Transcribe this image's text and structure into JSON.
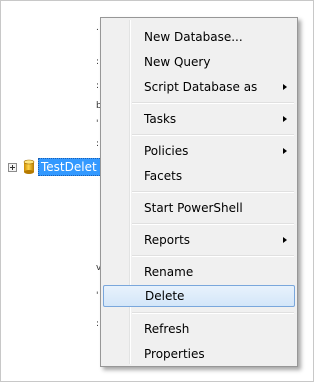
{
  "tree": {
    "node_label": "TestDelet"
  },
  "menu": {
    "items": [
      {
        "label": "New Database...",
        "submenu": false
      },
      {
        "label": "New Query",
        "submenu": false
      },
      {
        "label": "Script Database as",
        "submenu": true
      },
      {
        "label": "Tasks",
        "submenu": true
      },
      {
        "label": "Policies",
        "submenu": true
      },
      {
        "label": "Facets",
        "submenu": false
      },
      {
        "label": "Start PowerShell",
        "submenu": false
      },
      {
        "label": "Reports",
        "submenu": true
      },
      {
        "label": "Rename",
        "submenu": false
      },
      {
        "label": "Delete",
        "submenu": false,
        "highlighted": true
      },
      {
        "label": "Refresh",
        "submenu": false
      },
      {
        "label": "Properties",
        "submenu": false
      }
    ]
  },
  "colors": {
    "selection": "#3399ff",
    "menu_background": "#f0f0f0",
    "highlight_border": "#7aa7dc"
  },
  "icons": {
    "expander": "plus-box-icon",
    "database": "database-cylinder-icon",
    "submenu": "triangle-right-icon"
  }
}
